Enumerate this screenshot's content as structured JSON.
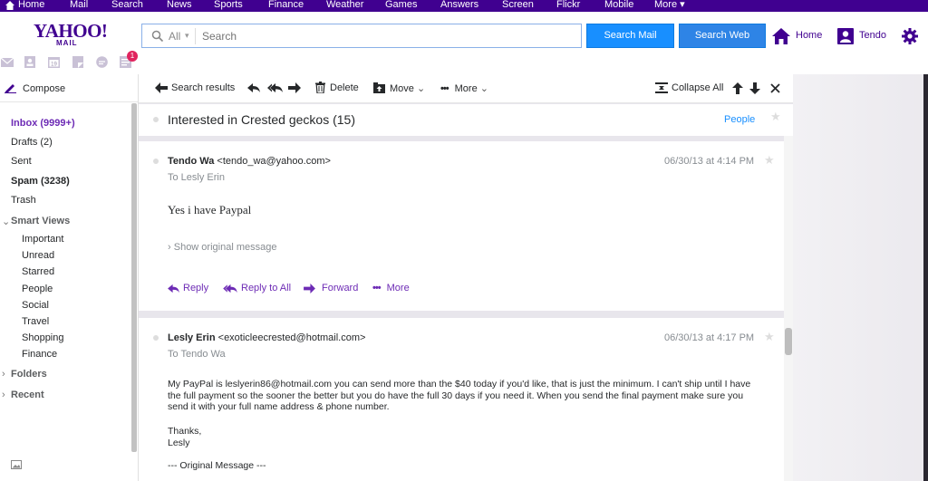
{
  "topnav": {
    "items": [
      "Home",
      "Mail",
      "Search",
      "News",
      "Sports",
      "Finance",
      "Weather",
      "Games",
      "Answers",
      "Screen",
      "Flickr",
      "Mobile",
      "More"
    ]
  },
  "header": {
    "logo": "YAHOO!",
    "logo_sub": "MAIL",
    "search_scope": "All",
    "search_placeholder": "Search",
    "search_mail_label": "Search Mail",
    "search_web_label": "Search Web",
    "home_label": "Home",
    "user_label": "Tendo",
    "notification_count": "1"
  },
  "sidebar": {
    "compose": "Compose",
    "folders": [
      {
        "label": "Inbox (9999+)"
      },
      {
        "label": "Drafts (2)"
      },
      {
        "label": "Sent"
      },
      {
        "label": "Spam (3238)"
      },
      {
        "label": "Trash"
      }
    ],
    "smart_views_label": "Smart Views",
    "smart_views": [
      "Important",
      "Unread",
      "Starred",
      "People",
      "Social",
      "Travel",
      "Shopping",
      "Finance"
    ],
    "folders_label": "Folders",
    "recent_label": "Recent"
  },
  "toolbar": {
    "back_label": "Search results",
    "delete_label": "Delete",
    "move_label": "Move",
    "more_label": "More",
    "collapse_label": "Collapse All"
  },
  "conversation": {
    "subject": "Interested in Crested geckos (15)",
    "people_label": "People"
  },
  "messages": [
    {
      "sender_name": "Tendo Wa",
      "sender_email": "<tendo_wa@yahoo.com>",
      "to": "To  Lesly Erin",
      "date": "06/30/13 at 4:14 PM",
      "body": "Yes i have Paypal",
      "show_original": "Show original message",
      "actions": {
        "reply": "Reply",
        "reply_all": "Reply to All",
        "forward": "Forward",
        "more": "More"
      }
    },
    {
      "sender_name": "Lesly Erin",
      "sender_email": "<exoticleecrested@hotmail.com>",
      "to": "To  Tendo Wa",
      "date": "06/30/13 at 4:17 PM",
      "body": "My PayPal is leslyerin86@hotmail.com you can send more than the $40 today if you'd like, that is just the minimum. I can't ship until I have the full payment so the sooner the better but you do have the full 30 days if you need it. When you send the final payment make sure you send it with your full name address & phone number.",
      "thanks": "Thanks,",
      "signature": "Lesly",
      "original_message": "--- Original Message ---"
    }
  ],
  "colors": {
    "brand_purple": "#400090",
    "link_purple": "#6d2bb5",
    "button_blue": "#188fff"
  }
}
